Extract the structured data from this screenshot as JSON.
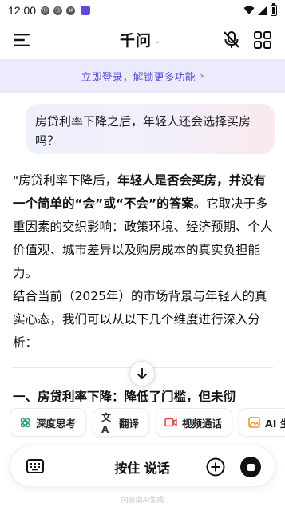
{
  "status_bar": {
    "time": "12:00",
    "notif_icons": [
      "⑬",
      "⑬",
      "⑩"
    ]
  },
  "header": {
    "title": "千问",
    "title_chevron": "⌄",
    "icons": [
      "menu-icon",
      "mic-off-icon",
      "grid-icon"
    ]
  },
  "login_banner": {
    "text": "立即登录，解锁更多功能",
    "chevron": "›"
  },
  "chat": {
    "user_message": "房贷利率下降之后，年轻人还会选择买房吗？",
    "answer": {
      "p1_start": "\"房贷利率下降后，",
      "p1_bold": "年轻人是否会买房，并没有一个简单的“会”或“不会”的答案",
      "p1_end": "。它取决于多重因素的交织影响：政策环境、经济预期、个人价值观、城市差异以及购房成本的真实负担能力。",
      "p2": "结合当前（2025年）的市场背景与年轻人的真实心态，我们可以从以下几个维度进行深入分析：",
      "section_heading": "一、房贷利率下降：降低了门槛，但未彻"
    }
  },
  "chips": [
    {
      "label": "深度思考",
      "icon": "think-icon",
      "color": "#2fa36b"
    },
    {
      "label": "翻译",
      "icon": "translate-icon",
      "color": "#333333"
    },
    {
      "label": "视频通话",
      "icon": "video-call-icon",
      "color": "#e0453a"
    },
    {
      "label": "AI 生",
      "icon": "image-icon",
      "color": "#e89a2c"
    }
  ],
  "input_bar": {
    "hold_to_talk": "按住 说话"
  },
  "footer": {
    "note": "内容由AI生成"
  },
  "colors": {
    "accent": "#5a4fcf",
    "banner_bg": "#ecebfd"
  }
}
